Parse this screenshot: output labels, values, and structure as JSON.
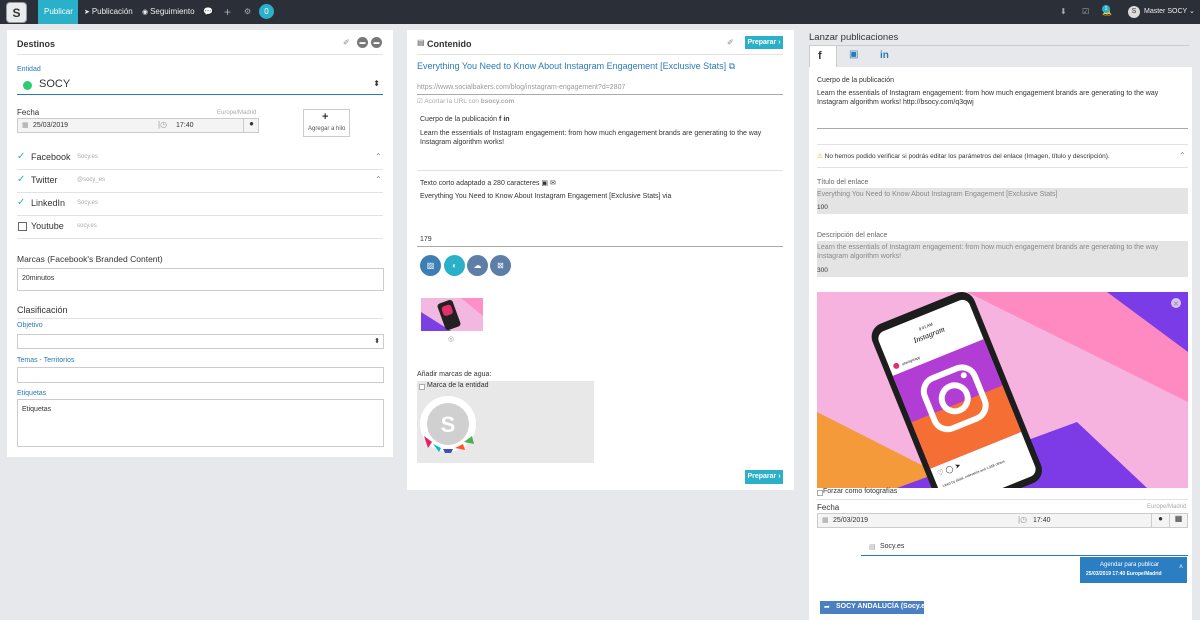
{
  "topbar": {
    "logo": "S",
    "tabs": [
      "Publicar",
      "Publicación",
      "Seguimiento"
    ],
    "notif_count": "0",
    "alert_count": "1",
    "user": "Master SOCY"
  },
  "destinos": {
    "title": "Destinos",
    "entidad_label": "Entidad",
    "entidad_value": "SOCY",
    "fecha_label": "Fecha",
    "timezone": "Europe/Madrid",
    "date": "25/03/2019",
    "time": "17:40",
    "add_thread": "Agregar a hilo",
    "networks": [
      {
        "name": "Facebook",
        "account": "Socy.es"
      },
      {
        "name": "Twitter",
        "account": "@socy_es"
      },
      {
        "name": "LinkedIn",
        "account": "Socy.es"
      },
      {
        "name": "Youtube",
        "account": "socy.es"
      }
    ],
    "marcas_label": "Marcas (Facebook's Branded Content)",
    "marcas_value": "20minutos",
    "clasificacion": "Clasificación",
    "objetivo_label": "Objetivo",
    "temas_label": "Temas - Territorios",
    "etiquetas_label": "Etiquetas",
    "etiquetas_placeholder": "Etiquetas"
  },
  "contenido": {
    "title": "Contenido",
    "preparar": "Preparar ›",
    "link_title": "Everything You Need to Know About Instagram Engagement [Exclusive Stats]",
    "url": "https://www.socialbakers.com/blog/instagram-engagement?d=2807",
    "acortar": "Acortar la URL con",
    "acortar_domain": "bsocy.com",
    "cuerpo_label": "Cuerpo de la publicación",
    "cuerpo_text1": "Learn the essentials of Instagram engagement: from how much engagement brands are generating to the way",
    "cuerpo_text2": "Instagram algorithm works!",
    "texto_corto_label": "Texto corto adaptado a 280 caracteres",
    "texto_corto": "Everything You Need to Know About Instagram Engagement [Exclusive Stats] via",
    "char_count": "179",
    "watermark_label": "Añadir marcas de agua:",
    "marca_entidad": "Marca de la entidad"
  },
  "lanzar": {
    "title": "Lanzar publicaciones",
    "cuerpo_label": "Cuerpo de la publicación",
    "cuerpo_text1": "Learn the essentials of Instagram engagement: from how much engagement brands are generating to the way",
    "cuerpo_text2": "Instagram algorithm works! http://bsocy.com/q3qwj",
    "warning": "No hemos podido verificar si podrás editar los parámetros del enlace (Imagen, título y descripción).",
    "titulo_label": "Título del enlace",
    "titulo_value": "Everything You Need to Know About Instagram Engagement [Exclusive Stats]",
    "titulo_count": "100",
    "descripcion_label": "Descripción del enlace",
    "descripcion_text1": "Learn the essentials of Instagram engagement: from how much engagement brands are generating to the way",
    "descripcion_text2": "Instagram algorithm works!",
    "descripcion_count": "300",
    "forzar": "Forzar como fotografías",
    "fecha_label": "Fecha",
    "timezone": "Europe/Madrid",
    "date": "25/03/2019",
    "time": "17:40",
    "account": "Socy.es",
    "agendar_line1": "Agendar para publicar",
    "agendar_line2": "25/03/2019 17:40 Europe/Madrid",
    "andalucia": "SOCY ANDALUCÍA (Socy.es)",
    "phone_app": "Instagram",
    "phone_time": "9:41 AM",
    "phone_handle": "afterlightapp",
    "phone_likes": "Liked by alidal, noleweiss and 1,058 others"
  },
  "colors": {
    "accent": "#2ab0c9",
    "topbar": "#2b3038",
    "blue_link": "#2a7ab8",
    "agendar": "#2b7ec1"
  }
}
